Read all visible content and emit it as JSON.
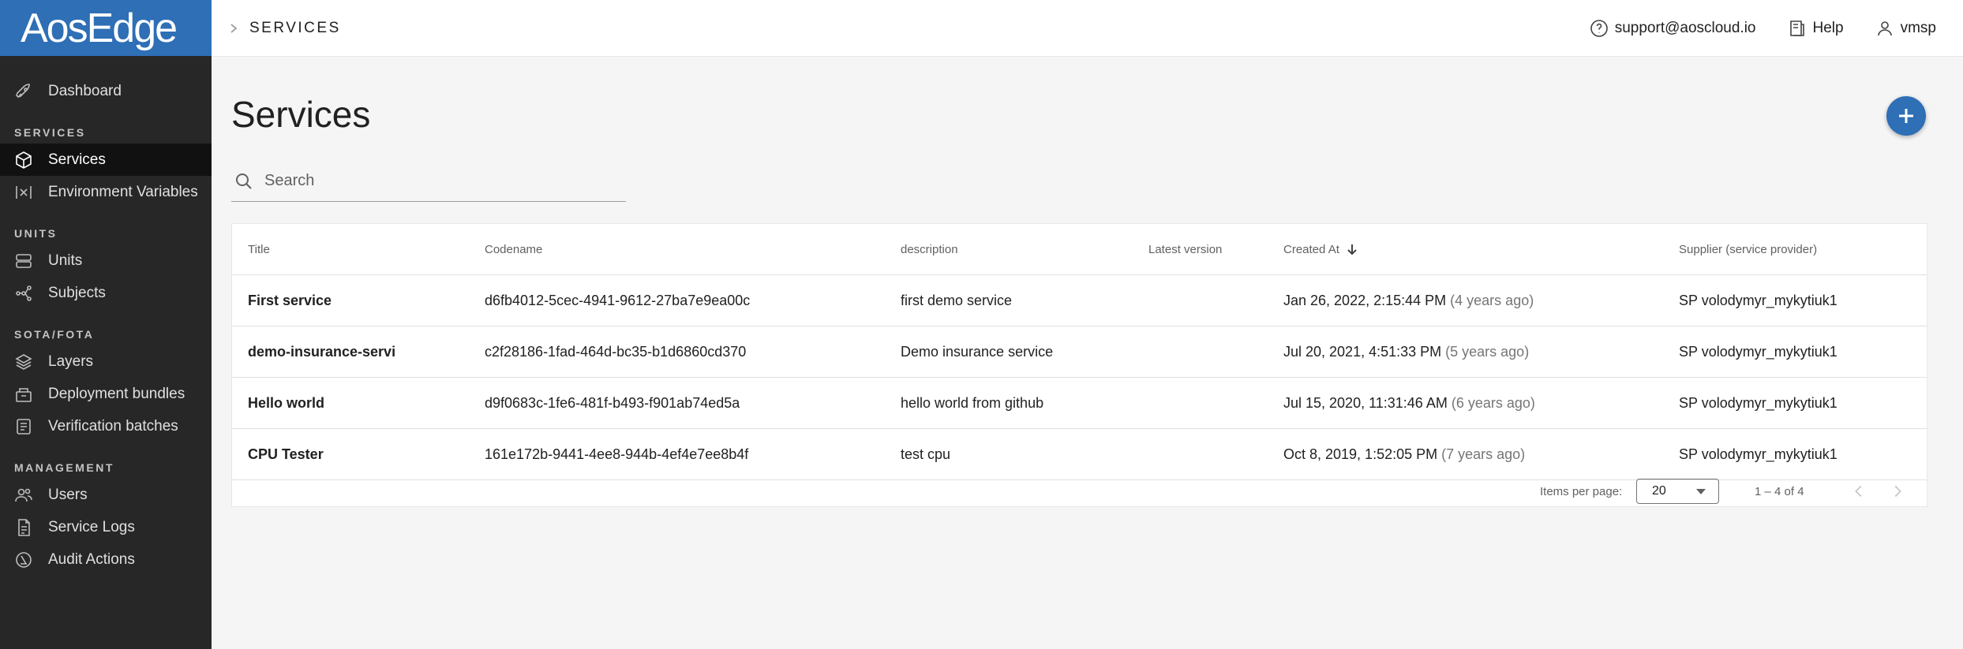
{
  "app": {
    "logo": "AosEdge"
  },
  "sidebar": {
    "dashboard": "Dashboard",
    "sections": {
      "services": "SERVICES",
      "units": "UNITS",
      "sota": "SOTA/FOTA",
      "management": "MANAGEMENT"
    },
    "items": {
      "services": "Services",
      "env_vars": "Environment Variables",
      "units": "Units",
      "subjects": "Subjects",
      "layers": "Layers",
      "deployment": "Deployment bundles",
      "verification": "Verification batches",
      "users": "Users",
      "service_logs": "Service Logs",
      "audit": "Audit Actions"
    }
  },
  "header": {
    "breadcrumb": "SERVICES",
    "support": "support@aoscloud.io",
    "help": "Help",
    "user": "vmsp"
  },
  "main": {
    "title": "Services",
    "search_placeholder": "Search"
  },
  "table": {
    "columns": {
      "title": "Title",
      "codename": "Codename",
      "description": "description",
      "latest": "Latest version",
      "created": "Created At",
      "supplier": "Supplier (service provider)"
    },
    "rows": [
      {
        "title": "First service",
        "codename": "d6fb4012-5cec-4941-9612-27ba7e9ea00c",
        "description": "first demo service",
        "latest": "",
        "created": "Jan 26, 2022, 2:15:44 PM",
        "ago": "(4 years ago)",
        "supplier": "SP volodymyr_mykytiuk1"
      },
      {
        "title": "demo-insurance-servi",
        "codename": "c2f28186-1fad-464d-bc35-b1d6860cd370",
        "description": "Demo insurance service",
        "latest": "",
        "created": "Jul 20, 2021, 4:51:33 PM",
        "ago": "(5 years ago)",
        "supplier": "SP volodymyr_mykytiuk1"
      },
      {
        "title": "Hello world",
        "codename": "d9f0683c-1fe6-481f-b493-f901ab74ed5a",
        "description": "hello world from github",
        "latest": "",
        "created": "Jul 15, 2020, 11:31:46 AM",
        "ago": "(6 years ago)",
        "supplier": "SP volodymyr_mykytiuk1"
      },
      {
        "title": "CPU Tester",
        "codename": "161e172b-9441-4ee8-944b-4ef4e7ee8b4f",
        "description": "test cpu",
        "latest": "",
        "created": "Oct 8, 2019, 1:52:05 PM",
        "ago": "(7 years ago)",
        "supplier": "SP volodymyr_mykytiuk1"
      }
    ]
  },
  "paginator": {
    "label": "Items per page:",
    "page_size": "20",
    "range": "1 – 4 of 4"
  },
  "colors": {
    "brand": "#2e6fb6",
    "sidebar_bg": "#272727"
  }
}
